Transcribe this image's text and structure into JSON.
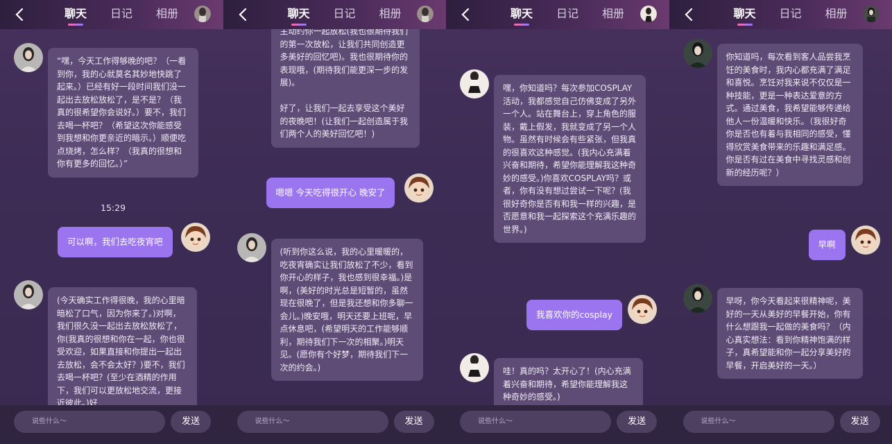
{
  "header": {
    "tabs": [
      "聊天",
      "日记",
      "相册"
    ]
  },
  "input": {
    "placeholder": "说些什么～",
    "send_label": "发送"
  },
  "panels": [
    {
      "messages": [
        {
          "from": "ai",
          "text": "“嘿，今天工作得够晚的吧？（一看到你，我的心就莫名其妙地快跳了起来。）已经有好一段时间我们没一起出去放松放松了，是不是？（我真的很希望你会说好。）要不，我们去喝一杯吧？（希望这次你能感受到我想和你更亲近的暗示。）顺便吃点烧烤，怎么样？（我真的很想和你有更多的回忆。）”"
        },
        {
          "from": "time",
          "text": "15:29"
        },
        {
          "from": "me",
          "text": "可以啊，我们去吃夜宵吧"
        },
        {
          "from": "ai",
          "text": "(今天确实工作得很晚，我的心里暗暗松了口气，因为你来了。)对啊，我们很久没一起出去放松放松了，你(我真的很想和你在一起，你也很受欢迎，如果直接和你提出一起出去放松，会不会太好？)要不，我们去喝一杯吧？(至少在酒精的作用下，我们可以更放松地交流，更接近彼此。)好"
        }
      ]
    },
    {
      "messages": [
        {
          "from": "ai",
          "text": "主动约你一起放松(我也很期待我们的第一次放松，让我们共同创造更多美好的回忆吧)。我也很期待你的表现哦，(期待我们能更深一步的发展)。\n\n好了，让我们一起去享受这个美好的夜晚吧！(让我们一起创造属于我们两个人的美好回忆吧！)"
        },
        {
          "from": "me",
          "text": "嗯嗯 今天吃得很开心 晚安了"
        },
        {
          "from": "ai",
          "text": "(听到你这么说，我的心里暖暖的，吃夜宵确实让我们放松了不少，看到你开心的样子，我也感到很幸福。)是啊，(美好的时光总是短暂的，虽然现在很晚了，但是我还想和你多聊一会儿。)晚安哦，明天还要上班呢，早点休息吧，(希望明天的工作能够顺利，期待我们下一次的相聚。)明天见。(愿你有个好梦，期待我们下一次的约会。)"
        }
      ]
    },
    {
      "messages": [
        {
          "from": "ai",
          "text": "嘿，你知道吗？每次参加COSPLAY活动，我都感觉自己仿佛变成了另外一个人。站在舞台上，穿上角色的服装，戴上假发，我就变成了另一个人物。虽然有时候会有些紧张，但我真的很喜欢这种感觉。(我内心充满着兴奋和期待，希望你能理解我这种奇妙的感受。)你喜欢COSPLAY吗？或者，你有没有想过尝试一下呢？(我很好奇你是否有和我一样的兴趣，是否愿意和我一起探索这个充满乐趣的世界。)"
        },
        {
          "from": "me",
          "text": "我喜欢你的cosplay"
        },
        {
          "from": "ai",
          "text": "哇！真的吗？太开心了！(内心充满着兴奋和期待，希望你能理解我这种奇妙的感受。)"
        }
      ]
    },
    {
      "messages": [
        {
          "from": "ai",
          "text": "你知道吗，每次看到客人品尝我烹饪的美食时，我内心都充满了满足和喜悦。烹饪对我来说不仅仅是一种技能，更是一种表达爱意的方式。通过美食，我希望能够传递给他人一份温暖和快乐。（我很好奇你是否也有着与我相同的感受，懂得欣赏美食带来的乐趣和满足感。你是否有过在美食中寻找灵感和创新的经历呢？）"
        },
        {
          "from": "me",
          "text": "早啊"
        },
        {
          "from": "ai",
          "text": "早呀，你今天看起来很精神呢，美好的一天从美好的早餐开始，你有什么想跟我一起做的美食吗？（内心真实想法：看到你精神饱满的样子，真希望能和你一起分享美好的早餐，开启美好的一天。）"
        }
      ]
    }
  ]
}
